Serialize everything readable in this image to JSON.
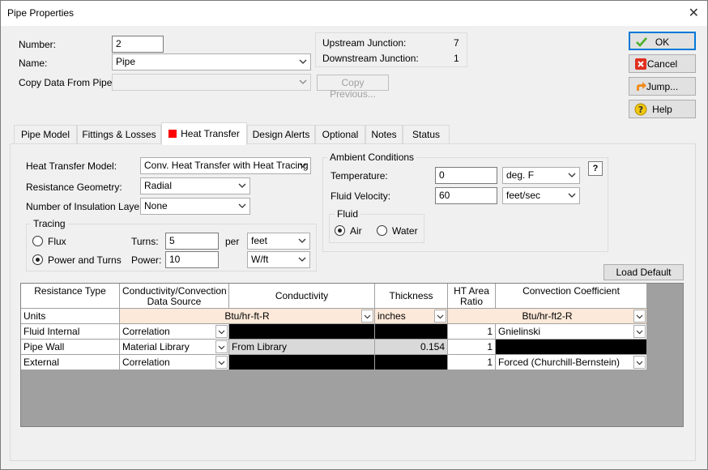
{
  "window": {
    "title": "Pipe Properties"
  },
  "general": {
    "number_label": "Number:",
    "number_value": "2",
    "name_label": "Name:",
    "name_value": "Pipe",
    "copy_label": "Copy Data From Pipe...",
    "copy_value": "",
    "copy_previous_label": "Copy Previous..."
  },
  "junctions": {
    "upstream_label": "Upstream Junction:",
    "upstream_value": "7",
    "downstream_label": "Downstream Junction:",
    "downstream_value": "1"
  },
  "side_buttons": {
    "ok": "OK",
    "cancel": "Cancel",
    "jump": "Jump...",
    "help": "Help"
  },
  "tabs": [
    {
      "label": "Pipe Model"
    },
    {
      "label": "Fittings & Losses"
    },
    {
      "label": "Heat Transfer"
    },
    {
      "label": "Design Alerts"
    },
    {
      "label": "Optional"
    },
    {
      "label": "Notes"
    },
    {
      "label": "Status"
    }
  ],
  "heat_transfer": {
    "model_label": "Heat Transfer Model:",
    "model_value": "Conv. Heat Transfer with Heat Tracing",
    "geometry_label": "Resistance Geometry:",
    "geometry_value": "Radial",
    "insulation_label": "Number of Insulation Layers:",
    "insulation_value": "None",
    "tracing": {
      "group_label": "Tracing",
      "flux_label": "Flux",
      "power_turns_label": "Power and Turns",
      "selected": "Power and Turns",
      "turns_label": "Turns:",
      "turns_value": "5",
      "turns_unit_label": "per",
      "turns_unit_value": "feet",
      "power_label": "Power:",
      "power_value": "10",
      "power_unit_value": "W/ft"
    },
    "ambient": {
      "group_label": "Ambient Conditions",
      "temperature_label": "Temperature:",
      "temperature_value": "0",
      "temperature_unit": "deg. F",
      "velocity_label": "Fluid Velocity:",
      "velocity_value": "60",
      "velocity_unit": "feet/sec",
      "help_label": "?",
      "fluid": {
        "group_label": "Fluid",
        "air_label": "Air",
        "water_label": "Water",
        "selected": "Air"
      }
    },
    "load_default_label": "Load Default"
  },
  "grid": {
    "headers": {
      "type": "Resistance Type",
      "source": "Conductivity/Convection Data Source",
      "conductivity": "Conductivity",
      "thickness": "Thickness",
      "ratio": "HT Area Ratio",
      "coefficient": "Convection Coefficient"
    },
    "units": {
      "label": "Units",
      "conductivity": "Btu/hr-ft-R",
      "thickness": "inches",
      "coefficient": "Btu/hr-ft2-R"
    },
    "rows": [
      {
        "type": "Fluid Internal",
        "source": "Correlation",
        "conductivity": "",
        "thickness": "",
        "ratio": "1",
        "coefficient": "Gnielinski"
      },
      {
        "type": "Pipe Wall",
        "source": "Material Library",
        "conductivity": "From Library",
        "thickness": "0.154",
        "ratio": "1",
        "coefficient": ""
      },
      {
        "type": "External",
        "source": "Correlation",
        "conductivity": "",
        "thickness": "",
        "ratio": "1",
        "coefficient": "Forced (Churchill-Bernstein)"
      }
    ]
  },
  "colors": {
    "accent": "#0078d7",
    "tab_marker": "#ff0000",
    "units_row": "#fde9d9",
    "grid_background": "#a0a0a0"
  },
  "icons": {
    "ok": "check-icon",
    "cancel": "close-icon",
    "jump": "jump-arrow-icon",
    "help": "help-icon",
    "heat_transfer_tab": "red-square-icon"
  }
}
